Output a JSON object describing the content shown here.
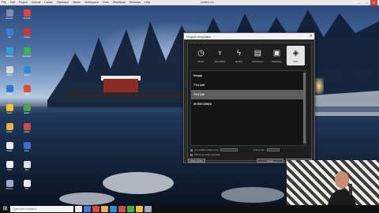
{
  "menubar": {
    "items": [
      "File",
      "Edit",
      "Project",
      "Journal",
      "Create",
      "Clipboard",
      "Viewer",
      "Workspace",
      "Tools",
      "Workflows",
      "Windows",
      "Help"
    ],
    "title": "untitled.mlt"
  },
  "desktop": {
    "icons": [
      {
        "label": "Recycle",
        "color": "#7a8fb0"
      },
      {
        "label": "Chrome",
        "color": "#e0483e"
      },
      {
        "label": "PC",
        "color": "#3b7dd8"
      },
      {
        "label": "Opera",
        "color": "#d0313a"
      },
      {
        "label": "Settings",
        "color": "#2f9fd6"
      },
      {
        "label": "Camtasia",
        "color": "#3bb54a"
      },
      {
        "label": "Player",
        "color": "#d8d8d8"
      },
      {
        "label": "Store",
        "color": "#2a8cd4"
      },
      {
        "label": "Edge",
        "color": "#2d7bd1"
      },
      {
        "label": "Video",
        "color": "#e04c2f"
      },
      {
        "label": "Notes",
        "color": "#f1c232"
      },
      {
        "label": "Editor",
        "color": "#4aa34a"
      },
      {
        "label": "Folder",
        "color": "#e8b24a"
      },
      {
        "label": "Media",
        "color": "#d14b4b"
      },
      {
        "label": "Audio",
        "color": "#e9e9e9"
      },
      {
        "label": "Docs",
        "color": "#3a6fd1"
      },
      {
        "label": "Paint",
        "color": "#f0f0f0"
      },
      {
        "label": "Doc",
        "color": "#dcdcdc"
      },
      {
        "label": "Archive",
        "color": "#9aa9c4"
      },
      {
        "label": "File",
        "color": "#e9e9e9"
      }
    ]
  },
  "dialog": {
    "title": "Project templates",
    "close_label": "✕",
    "tabs": [
      {
        "label": "Music",
        "icon": "clock-icon",
        "glyph": "◷"
      },
      {
        "label": "Recording",
        "icon": "mic-icon",
        "glyph": "♆"
      },
      {
        "label": "Quality",
        "icon": "bolt-icon",
        "glyph": "ϟ"
      },
      {
        "label": "Resolution",
        "icon": "film-icon",
        "glyph": "▤"
      },
      {
        "label": "Watching",
        "icon": "cassette-icon",
        "glyph": "▣"
      },
      {
        "label": "Misc",
        "icon": "tag-icon",
        "glyph": "◈"
      }
    ],
    "active_tab": 5,
    "list": [
      "Empty",
      "TYO AM",
      "TYO AM",
      "00 RECORDS"
    ],
    "selected_index": 2,
    "options": {
      "row1_label": "Use profile to frame size",
      "row1_value": "",
      "row1_right_label": "Frame rate",
      "row2_label": "Persist as project template"
    },
    "buttons": {
      "left": "Open Folder",
      "ok": "Create",
      "cancel": "Cancel"
    }
  },
  "taskbar": {
    "search_placeholder": "Type here to search",
    "apps": [
      "#e9e9e9",
      "#3b7dd8",
      "#e0483e",
      "#e8b24a",
      "#2a8cd4",
      "#d14b4b",
      "#3bb54a",
      "#f1c232",
      "#9aa9c4"
    ]
  }
}
